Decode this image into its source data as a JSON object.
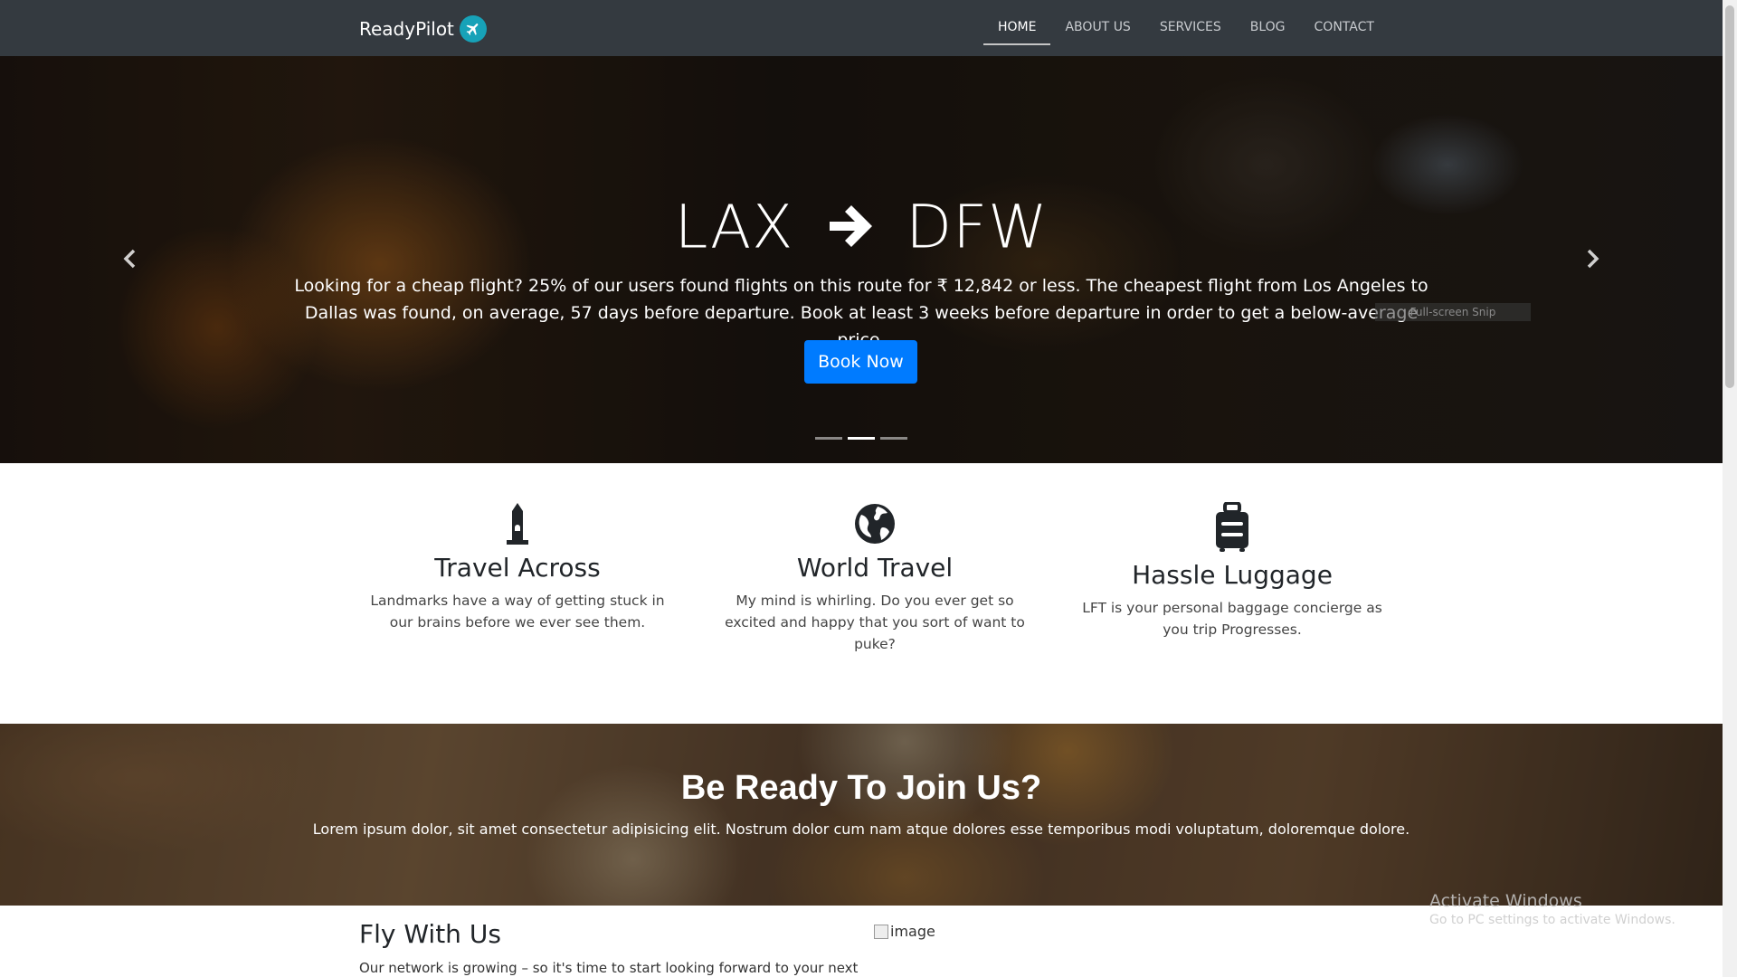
{
  "navbar": {
    "brand": "ReadyPilot",
    "brand_icon": "airplane-icon",
    "links": [
      {
        "label": "HOME",
        "active": true
      },
      {
        "label": "ABOUT US",
        "active": false
      },
      {
        "label": "SERVICES",
        "active": false
      },
      {
        "label": "BLOG",
        "active": false
      },
      {
        "label": "CONTACT",
        "active": false
      }
    ]
  },
  "hero": {
    "origin": "LAX",
    "destination": "DFW",
    "arrow_icon": "arrow-right-icon",
    "description": "Looking for a cheap flight? 25% of our users found flights on this route for ₹ 12,842 or less. The cheapest flight from Los Angeles to Dallas was found, on average, 57 days before departure. Book at least 3 weeks before departure in order to get a below-average price.",
    "button_label": "Book Now",
    "prev_icon": "chevron-left-icon",
    "next_icon": "chevron-right-icon",
    "slides": 3,
    "active_slide": 2,
    "overlay_snip": "Full-screen Snip"
  },
  "features": [
    {
      "icon": "monument-icon",
      "title": "Travel Across",
      "text": "Landmarks have a way of getting stuck in our brains before we ever see them."
    },
    {
      "icon": "globe-icon",
      "title": "World Travel",
      "text": "My mind is whirling. Do you ever get so excited and happy that you sort of want to puke?"
    },
    {
      "icon": "suitcase-icon",
      "title": "Hassle Luggage",
      "text": "LFT is your personal baggage concierge as you trip Progresses."
    }
  ],
  "join": {
    "title": "Be Ready To Join Us?",
    "text": "Lorem ipsum dolor, sit amet consectetur adipisicing elit. Nostrum dolor cum nam atque dolores esse temporibus modi voluptatum, doloremque dolore."
  },
  "fly": {
    "title": "Fly With Us",
    "text": "Our network is growing – so it's time to start looking forward to your next",
    "image_alt": "image"
  },
  "watermark": {
    "line1": "Activate Windows",
    "line2": "Go to PC settings to activate Windows."
  },
  "colors": {
    "navbar": "#343a40",
    "primary": "#007bff",
    "brand_icon_bg": "#17a2b8"
  }
}
